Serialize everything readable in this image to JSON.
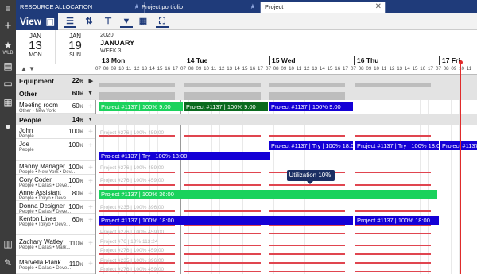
{
  "tabs": [
    {
      "label": "RESOURCE ALLOCATION"
    },
    {
      "label": "Project portfolio"
    },
    {
      "label": "Project"
    }
  ],
  "toolbar": {
    "view_label": "View"
  },
  "rail": {
    "wlb_label": "WLB"
  },
  "dates": {
    "from": {
      "month": "JAN",
      "day": "13",
      "weekday": "MON"
    },
    "to": {
      "month": "JAN",
      "day": "19",
      "weekday": "SUN"
    }
  },
  "calendar": {
    "year": "2020",
    "month": "JANUARY",
    "week": "WEEK 3",
    "days": [
      "13 Mon",
      "14 Tue",
      "15 Wed",
      "16 Thu",
      "17 Fri"
    ],
    "hours": [
      "07",
      "08",
      "09",
      "10",
      "11",
      "12",
      "13",
      "14",
      "15",
      "16",
      "17"
    ]
  },
  "rows": {
    "equipment": {
      "name": "Equipment",
      "pct": "22",
      "unit": "%"
    },
    "other": {
      "name": "Other",
      "pct": "60",
      "unit": "%"
    },
    "meeting": {
      "name": "Meeting room",
      "sub": "Other • New York",
      "pct": "60",
      "unit": "%"
    },
    "people": {
      "name": "People",
      "pct": "14",
      "unit": "%"
    },
    "john": {
      "name": "John",
      "sub": "People",
      "pct": "100",
      "unit": "%"
    },
    "joe": {
      "name": "Joe",
      "sub": "People",
      "pct": "100",
      "unit": "%"
    },
    "manny": {
      "name": "Manny Manager",
      "sub": "People • New York • Dev...",
      "pct": "100",
      "unit": "%"
    },
    "cory": {
      "name": "Cory Coder",
      "sub": "People • Dallas • Deve...",
      "pct": "100",
      "unit": "%"
    },
    "anne": {
      "name": "Anne Assistant",
      "sub": "People • Tokyo • Deve...",
      "pct": "80",
      "unit": "%"
    },
    "donna": {
      "name": "Donna Designer",
      "sub": "People • Dallas • Deve...",
      "pct": "100",
      "unit": "%"
    },
    "kenton": {
      "name": "Kenton Lines",
      "sub": "People • Tokyo • Deve...",
      "pct": "60",
      "unit": "%"
    },
    "zachary": {
      "name": "Zachary Watley",
      "sub": "People • Dallas • Mark...",
      "pct": "110",
      "unit": "%"
    },
    "marvella": {
      "name": "Marvella Plank",
      "sub": "People • Dallas • Deve...",
      "pct": "110",
      "unit": "%"
    }
  },
  "bars": {
    "meeting1": "Project #1137 | 100% 9:00",
    "meeting2": "Project #1137 | 100% 9:00",
    "meeting3": "Project #1137 | 100% 9:00",
    "joe1": "Project #1137 | Try | 100% 18:00",
    "joe2": "Project #1137 | Try | 100% 18:00",
    "joe3": "Project #1137 | Try | 100% 18:00",
    "joe4": "Project #1137 | Try | 100% 18:00",
    "anne": "Project #1137 | 100% 36:00",
    "kenton1": "Project #1137 | 100% 18:00",
    "kenton2": "Project #1137 | 100% 18:00"
  },
  "ghosts": {
    "john": "Project #276 | 100% 459:00",
    "manny": "Project #276 | 100% 459:00",
    "cory": "Project #276 | 100% 459:00",
    "donna": "Project #235 | 100% 396:00",
    "kenton": "Project #276 | 100% 459:00",
    "zachary": "Project #76 | 10% 113:24",
    "zachary2": "Project #276 | 100% 459:00",
    "marvella": "Project #235 | 100% 396:00",
    "marvella2": "Project #276 | 100% 459:00"
  },
  "tooltip": {
    "text": "Utilization 10%."
  }
}
